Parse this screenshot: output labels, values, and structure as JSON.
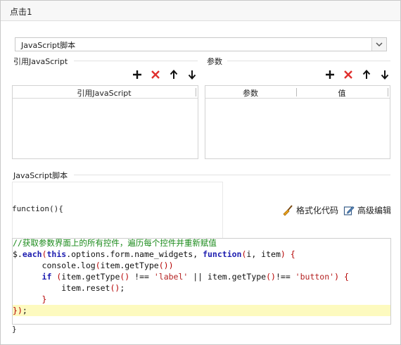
{
  "window": {
    "title": "点击1"
  },
  "script_type_select": {
    "value": "JavaScript脚本",
    "arrow": "chevron-down-icon"
  },
  "references": {
    "title": "引用JavaScript",
    "column_header": "引用JavaScript",
    "toolbar": [
      "add-icon",
      "delete-icon",
      "move-up-icon",
      "move-down-icon"
    ]
  },
  "params": {
    "title": "参数",
    "columns": [
      "参数",
      "值"
    ],
    "toolbar": [
      "add-icon",
      "delete-icon",
      "move-up-icon",
      "move-down-icon"
    ]
  },
  "script": {
    "title": "JavaScript脚本",
    "function_head": "function(){",
    "function_tail": "}",
    "format_code_label": "格式化代码",
    "advanced_edit_label": "高级编辑",
    "code_lines": [
      "//获取参数界面上的所有控件，遍历每个控件并重新赋值",
      "$.each(this.options.form.name_widgets, function(i, item) {",
      "    console.log(item.getType())",
      "    if (item.getType() !== 'label' || item.getType()!== 'button') {",
      "        item.reset();",
      "    }",
      "});"
    ]
  },
  "colors": {
    "delete": "#e0302e",
    "highlight_line": "#fdfabf",
    "comment": "#1a8a1a",
    "keyword": "#1d1db0"
  }
}
